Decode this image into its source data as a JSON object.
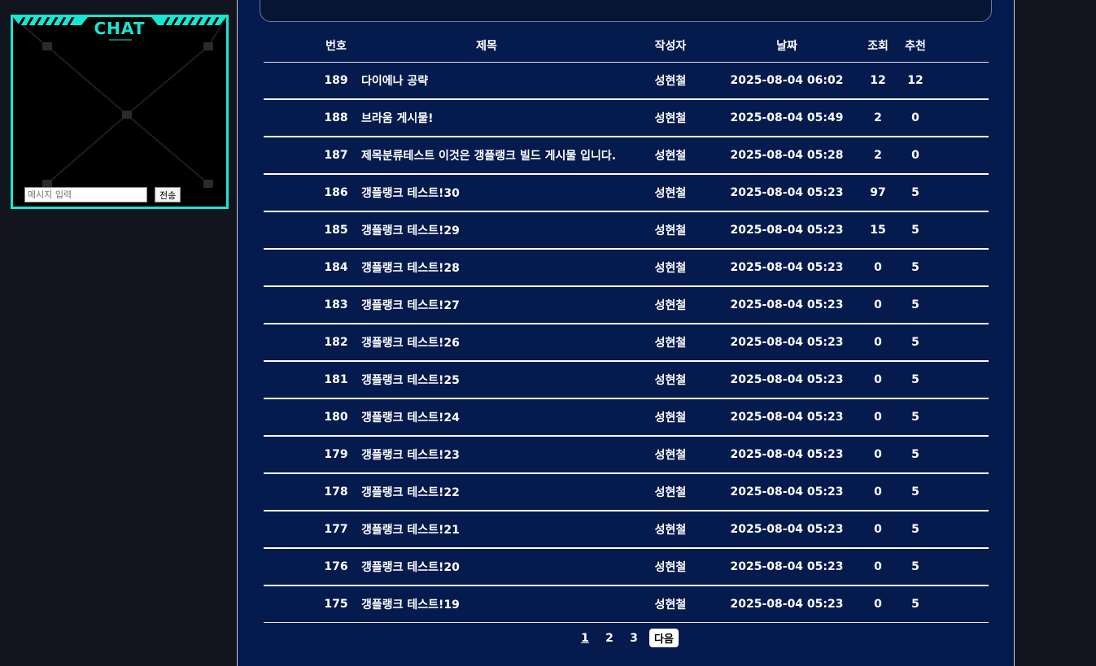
{
  "chat": {
    "title": "CHAT",
    "input_placeholder": "메시지 입력",
    "send_label": "전송"
  },
  "board": {
    "headers": {
      "num": "번호",
      "title": "제목",
      "author": "작성자",
      "date": "날짜",
      "views": "조회",
      "rec": "추천"
    },
    "rows": [
      {
        "num": "189",
        "title": "다이에나 공략",
        "author": "성현철",
        "date": "2025-08-04 06:02",
        "views": "12",
        "rec": "12"
      },
      {
        "num": "188",
        "title": "브라움 게시물!",
        "author": "성현철",
        "date": "2025-08-04 05:49",
        "views": "2",
        "rec": "0"
      },
      {
        "num": "187",
        "title": "제목분류테스트 이것은 갱플랭크 빌드 게시물 입니다.",
        "author": "성현철",
        "date": "2025-08-04 05:28",
        "views": "2",
        "rec": "0"
      },
      {
        "num": "186",
        "title": "갱플랭크 테스트!30",
        "author": "성현철",
        "date": "2025-08-04 05:23",
        "views": "97",
        "rec": "5"
      },
      {
        "num": "185",
        "title": "갱플랭크 테스트!29",
        "author": "성현철",
        "date": "2025-08-04 05:23",
        "views": "15",
        "rec": "5"
      },
      {
        "num": "184",
        "title": "갱플랭크 테스트!28",
        "author": "성현철",
        "date": "2025-08-04 05:23",
        "views": "0",
        "rec": "5"
      },
      {
        "num": "183",
        "title": "갱플랭크 테스트!27",
        "author": "성현철",
        "date": "2025-08-04 05:23",
        "views": "0",
        "rec": "5"
      },
      {
        "num": "182",
        "title": "갱플랭크 테스트!26",
        "author": "성현철",
        "date": "2025-08-04 05:23",
        "views": "0",
        "rec": "5"
      },
      {
        "num": "181",
        "title": "갱플랭크 테스트!25",
        "author": "성현철",
        "date": "2025-08-04 05:23",
        "views": "0",
        "rec": "5"
      },
      {
        "num": "180",
        "title": "갱플랭크 테스트!24",
        "author": "성현철",
        "date": "2025-08-04 05:23",
        "views": "0",
        "rec": "5"
      },
      {
        "num": "179",
        "title": "갱플랭크 테스트!23",
        "author": "성현철",
        "date": "2025-08-04 05:23",
        "views": "0",
        "rec": "5"
      },
      {
        "num": "178",
        "title": "갱플랭크 테스트!22",
        "author": "성현철",
        "date": "2025-08-04 05:23",
        "views": "0",
        "rec": "5"
      },
      {
        "num": "177",
        "title": "갱플랭크 테스트!21",
        "author": "성현철",
        "date": "2025-08-04 05:23",
        "views": "0",
        "rec": "5"
      },
      {
        "num": "176",
        "title": "갱플랭크 테스트!20",
        "author": "성현철",
        "date": "2025-08-04 05:23",
        "views": "0",
        "rec": "5"
      },
      {
        "num": "175",
        "title": "갱플랭크 테스트!19",
        "author": "성현철",
        "date": "2025-08-04 05:23",
        "views": "0",
        "rec": "5"
      }
    ]
  },
  "pagination": {
    "pages": [
      "1",
      "2",
      "3"
    ],
    "current": "1",
    "next_label": "다음"
  }
}
